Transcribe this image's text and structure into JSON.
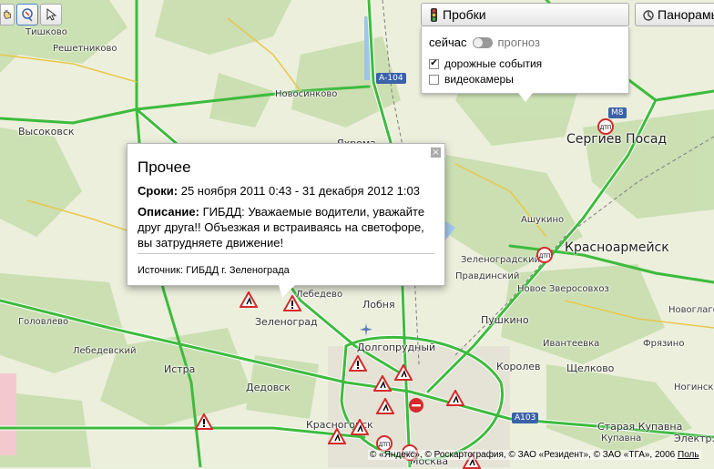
{
  "map": {
    "places": [
      {
        "name": "Тишково",
        "cls": "small"
      },
      {
        "name": "Решетниково",
        "cls": "small"
      },
      {
        "name": "Новосинково",
        "cls": "small"
      },
      {
        "name": "Высоковск",
        "cls": "medium"
      },
      {
        "name": "Яхрома",
        "cls": "medium"
      },
      {
        "name": "Сергиев Посад",
        "cls": "big"
      },
      {
        "name": "Ашукино",
        "cls": "small"
      },
      {
        "name": "Красноармейск",
        "cls": "big"
      },
      {
        "name": "Зеленоградский",
        "cls": "small"
      },
      {
        "name": "Правдинский",
        "cls": "small"
      },
      {
        "name": "Лобня",
        "cls": "medium"
      },
      {
        "name": "Зеленоград",
        "cls": "medium"
      },
      {
        "name": "Пушкино",
        "cls": "medium"
      },
      {
        "name": "Долгопрудный",
        "cls": "medium"
      },
      {
        "name": "Дедовск",
        "cls": "medium"
      },
      {
        "name": "Истра",
        "cls": "medium"
      },
      {
        "name": "Королев",
        "cls": "medium"
      },
      {
        "name": "Щелково",
        "cls": "medium"
      },
      {
        "name": "Красногорск",
        "cls": "medium"
      },
      {
        "name": "Старая Купавна",
        "cls": "medium"
      },
      {
        "name": "Электр...",
        "cls": "medium"
      },
      {
        "name": "Москва",
        "cls": "medium"
      },
      {
        "name": "Головлево",
        "cls": "small"
      },
      {
        "name": "Лебедево",
        "cls": "small"
      },
      {
        "name": "Новоглаголево",
        "cls": "small"
      },
      {
        "name": "Лебедевский",
        "cls": "small"
      },
      {
        "name": "Ивантеевка",
        "cls": "small"
      },
      {
        "name": "Фрязино",
        "cls": "small"
      },
      {
        "name": "Ногинско",
        "cls": "small"
      },
      {
        "name": "Купавна",
        "cls": "small"
      },
      {
        "name": "Новое Зверосовхоз",
        "cls": "small"
      }
    ],
    "shields": [
      "А-104",
      "М8",
      "А103"
    ]
  },
  "tools": [
    {
      "name": "hand-icon"
    },
    {
      "name": "ruler-icon"
    },
    {
      "name": "cursor-icon"
    }
  ],
  "traffic": {
    "label": "Пробки",
    "now": "сейчас",
    "forecast": "прогноз",
    "options": [
      {
        "label": "дорожные события",
        "checked": true
      },
      {
        "label": "видеокамеры",
        "checked": false
      }
    ]
  },
  "panorama": {
    "label": "Панорамы"
  },
  "popup": {
    "title": "Прочее",
    "dates_label": "Сроки:",
    "dates_value": " 25 ноября 2011 0:43 - 31 декабря 2012 1:03",
    "desc_label": "Описание:",
    "desc_value": " ГИБДД: Уважаемые водители, уважайте друг друга!! Объезжая и встраиваясь на светофоре, вы затрудняете движение!",
    "source": "Источник: ГИБДД г. Зеленограда"
  },
  "copyright": {
    "text": "© «Яндекс», © Роскартография, © ЗАО «Резидент», © ЗАО «ТГА», 2006",
    "link": "Поль"
  },
  "colors": {
    "road_green": "#3dbb3d",
    "forest": "#c9dfb0",
    "field": "#eef0de",
    "event_red": "#d42a2a"
  }
}
